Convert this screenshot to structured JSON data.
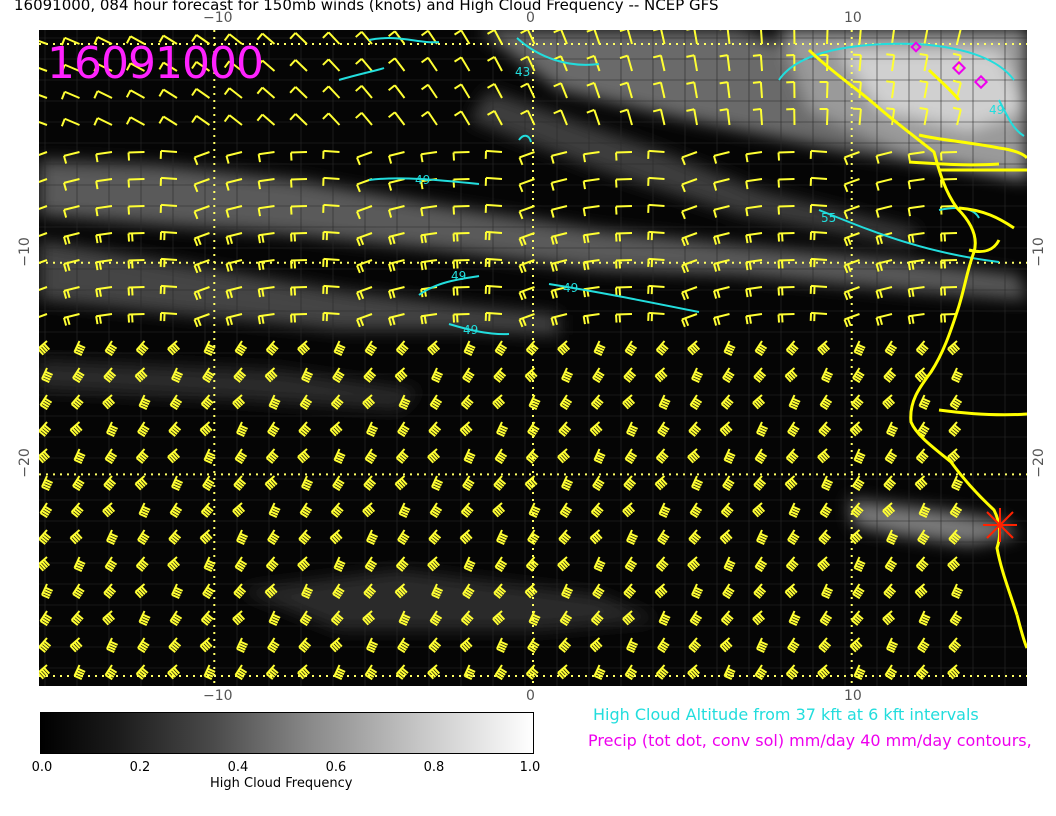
{
  "title": "16091000, 084 hour forecast for 150mb winds (knots) and High Cloud Frequency -- NCEP GFS",
  "stamp": "16091000",
  "x_axis": {
    "ticks": [
      "−10",
      "0",
      "10"
    ],
    "values": [
      -10,
      0,
      10
    ],
    "range": [
      -15.5,
      15.5
    ]
  },
  "y_axis": {
    "ticks": [
      "−10",
      "−20"
    ],
    "values": [
      -10,
      -20
    ],
    "range": [
      -30,
      1
    ]
  },
  "contour_labels": [
    "43",
    "49",
    "49",
    "49",
    "49",
    "55",
    "49"
  ],
  "colors": {
    "barb": "#ffff33",
    "coast": "#ffff00",
    "contour": "#22dddd",
    "precip": "#ee00ee",
    "grid": "#ffff66",
    "stamp": "#ff22ff"
  },
  "legend": {
    "colorbar_ticks": [
      "0.0",
      "0.2",
      "0.4",
      "0.6",
      "0.8",
      "1.0"
    ],
    "colorbar_values": [
      0.0,
      0.2,
      0.4,
      0.6,
      0.8,
      1.0
    ],
    "colorbar_label": "High Cloud Frequency",
    "note_cloud": "High Cloud Altitude from 37 kft at 6 kft intervals",
    "note_precip": "Precip (tot dot, conv sol) mm/day 40 mm/day contours,"
  },
  "wind_barbs": "wind barb field (yellow), 29 columns x 24 rows",
  "station_marker": "red-star-marker"
}
